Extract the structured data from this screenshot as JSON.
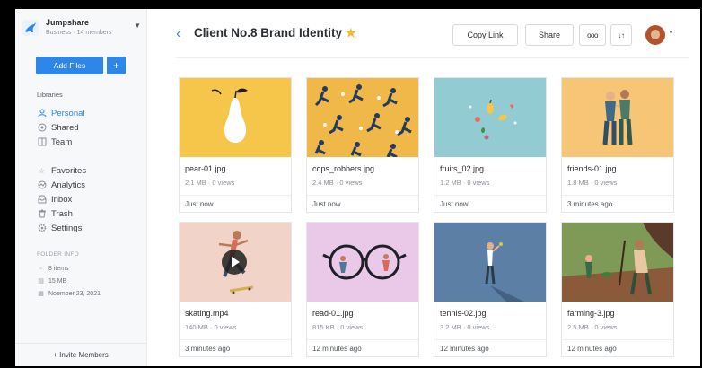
{
  "workspace": {
    "name": "Jumpshare",
    "plan": "Business · 14 members"
  },
  "sidebar": {
    "add_files_label": "Add Files",
    "add_plus_label": "+",
    "libraries_label": "Libraries",
    "libraries": [
      {
        "label": "Personal",
        "icon": "person-icon",
        "active": true
      },
      {
        "label": "Shared",
        "icon": "shared-icon",
        "active": false
      },
      {
        "label": "Team",
        "icon": "team-icon",
        "active": false
      }
    ],
    "tools": [
      {
        "label": "Favorites",
        "icon": "star-icon"
      },
      {
        "label": "Analytics",
        "icon": "analytics-icon"
      },
      {
        "label": "Inbox",
        "icon": "inbox-icon"
      },
      {
        "label": "Trash",
        "icon": "trash-icon"
      },
      {
        "label": "Settings",
        "icon": "gear-icon"
      }
    ],
    "folder_info": {
      "title": "FOLDER INFO",
      "items": "8 items",
      "size": "15 MB",
      "date": "Noember 23, 2021"
    },
    "invite_label": "+ Invite Members"
  },
  "header": {
    "title": "Client No.8 Brand Identity",
    "copy_link_label": "Copy Link",
    "share_label": "Share",
    "more_label": "ooo",
    "sort_label": "↓↑"
  },
  "colors": {
    "accent": "#2d87e8",
    "star": "#f5b921"
  },
  "files": [
    {
      "name": "pear-01.jpg",
      "meta": "2.1 MB · 0 views",
      "time": "Just now",
      "bg": "#f6c64a"
    },
    {
      "name": "cops_robbers.jpg",
      "meta": "2.4 MB · 0 views",
      "time": "Just now",
      "bg": "#f0b848"
    },
    {
      "name": "fruits_02.jpg",
      "meta": "1.2 MB · 0 views",
      "time": "Just now",
      "bg": "#93cbd3"
    },
    {
      "name": "friends-01.jpg",
      "meta": "1.8 MB · 0 views",
      "time": "3 minutes ago",
      "bg": "#f6c676"
    },
    {
      "name": "skating.mp4",
      "meta": "140 MB · 0 views",
      "time": "3 minutes ago",
      "bg": "#f2d3c8"
    },
    {
      "name": "read-01.jpg",
      "meta": "815 KB · 0 views",
      "time": "12 minutes ago",
      "bg": "#e9c9e7"
    },
    {
      "name": "tennis-02.jpg",
      "meta": "3.2 MB · 0 views",
      "time": "12 minutes ago",
      "bg": "#5c7fa5"
    },
    {
      "name": "farming-3.jpg",
      "meta": "2.5 MB · 0 views",
      "time": "12 minutes ago",
      "bg": "#7f9a57"
    }
  ]
}
